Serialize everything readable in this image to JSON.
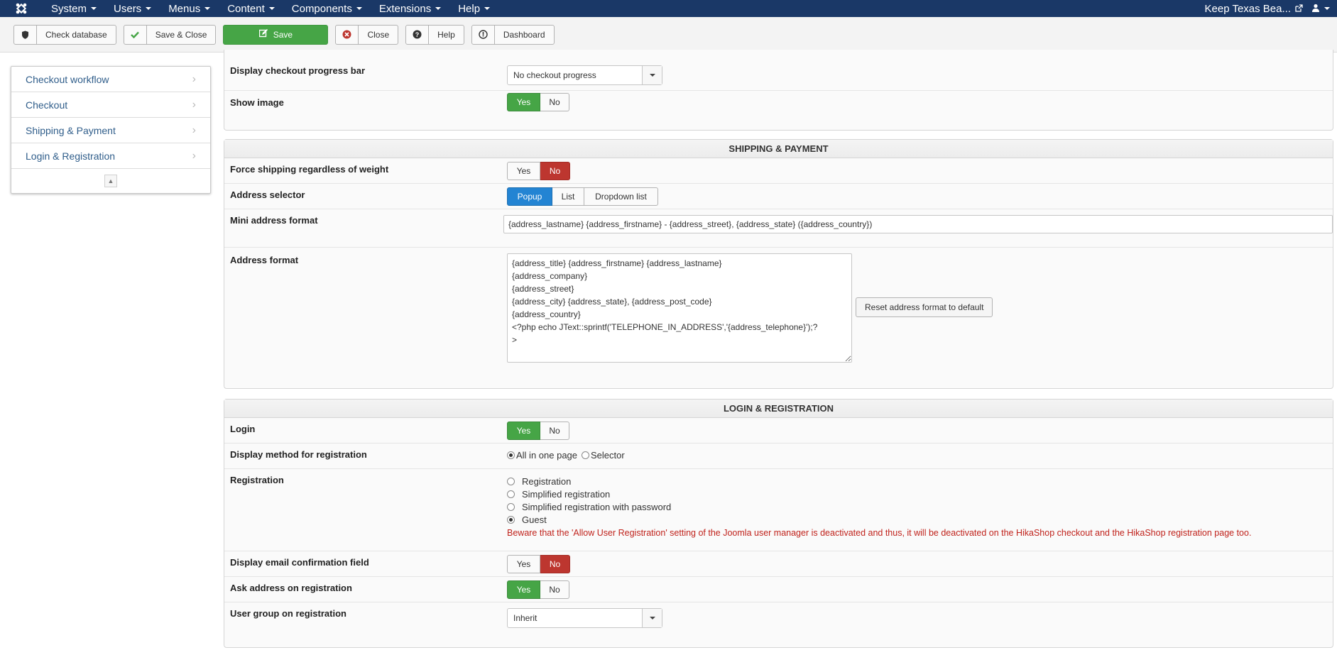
{
  "navbar": {
    "menu": [
      {
        "label": "System"
      },
      {
        "label": "Users"
      },
      {
        "label": "Menus"
      },
      {
        "label": "Content"
      },
      {
        "label": "Components"
      },
      {
        "label": "Extensions"
      },
      {
        "label": "Help"
      }
    ],
    "site_name": "Keep Texas Bea...",
    "icons": {
      "logo": "joomla-logo-icon",
      "external": "external-link-icon",
      "user": "user-icon"
    }
  },
  "toolbar": {
    "check_database": "Check database",
    "save_close": "Save & Close",
    "save": "Save",
    "close": "Close",
    "help": "Help",
    "dashboard": "Dashboard"
  },
  "sidebar": {
    "items": [
      {
        "label": "Checkout workflow"
      },
      {
        "label": "Checkout"
      },
      {
        "label": "Shipping & Payment"
      },
      {
        "label": "Login & Registration"
      }
    ]
  },
  "checkout_panel": {
    "progress_label": "Display checkout progress bar",
    "progress_value": "No checkout progress",
    "show_image_label": "Show image",
    "show_image_yes": "Yes",
    "show_image_no": "No"
  },
  "shipping_panel": {
    "title": "SHIPPING & PAYMENT",
    "force_label": "Force shipping regardless of weight",
    "force_yes": "Yes",
    "force_no": "No",
    "selector_label": "Address selector",
    "selector_options": [
      "Popup",
      "List",
      "Dropdown list"
    ],
    "mini_label": "Mini address format",
    "mini_value": "{address_lastname} {address_firstname} - {address_street}, {address_state} ({address_country})",
    "format_label": "Address format",
    "format_value": "{address_title} {address_firstname} {address_lastname}\n{address_company}\n{address_street}\n{address_city} {address_state}, {address_post_code}\n{address_country}\n<?php echo JText::sprintf('TELEPHONE_IN_ADDRESS','{address_telephone}');?\n>",
    "reset_button": "Reset address format to default"
  },
  "login_panel": {
    "title": "LOGIN & REGISTRATION",
    "login_label": "Login",
    "login_yes": "Yes",
    "login_no": "No",
    "display_method_label": "Display method for registration",
    "display_method_options": [
      "All in one page",
      "Selector"
    ],
    "registration_label": "Registration",
    "registration_options": [
      "Registration",
      "Simplified registration",
      "Simplified registration with password",
      "Guest"
    ],
    "registration_warning": "Beware that the 'Allow User Registration' setting of the Joomla user manager is deactivated and thus, it will be deactivated on the HikaShop checkout and the HikaShop registration page too.",
    "email_confirm_label": "Display email confirmation field",
    "email_confirm_yes": "Yes",
    "email_confirm_no": "No",
    "ask_address_label": "Ask address on registration",
    "ask_address_yes": "Yes",
    "ask_address_no": "No",
    "user_group_label": "User group on registration",
    "user_group_value": "Inherit"
  },
  "colors": {
    "navbar": "#1a3867",
    "green": "#46a546",
    "red": "#bd362f",
    "blue": "#2384d3",
    "warning": "#c0231c"
  }
}
